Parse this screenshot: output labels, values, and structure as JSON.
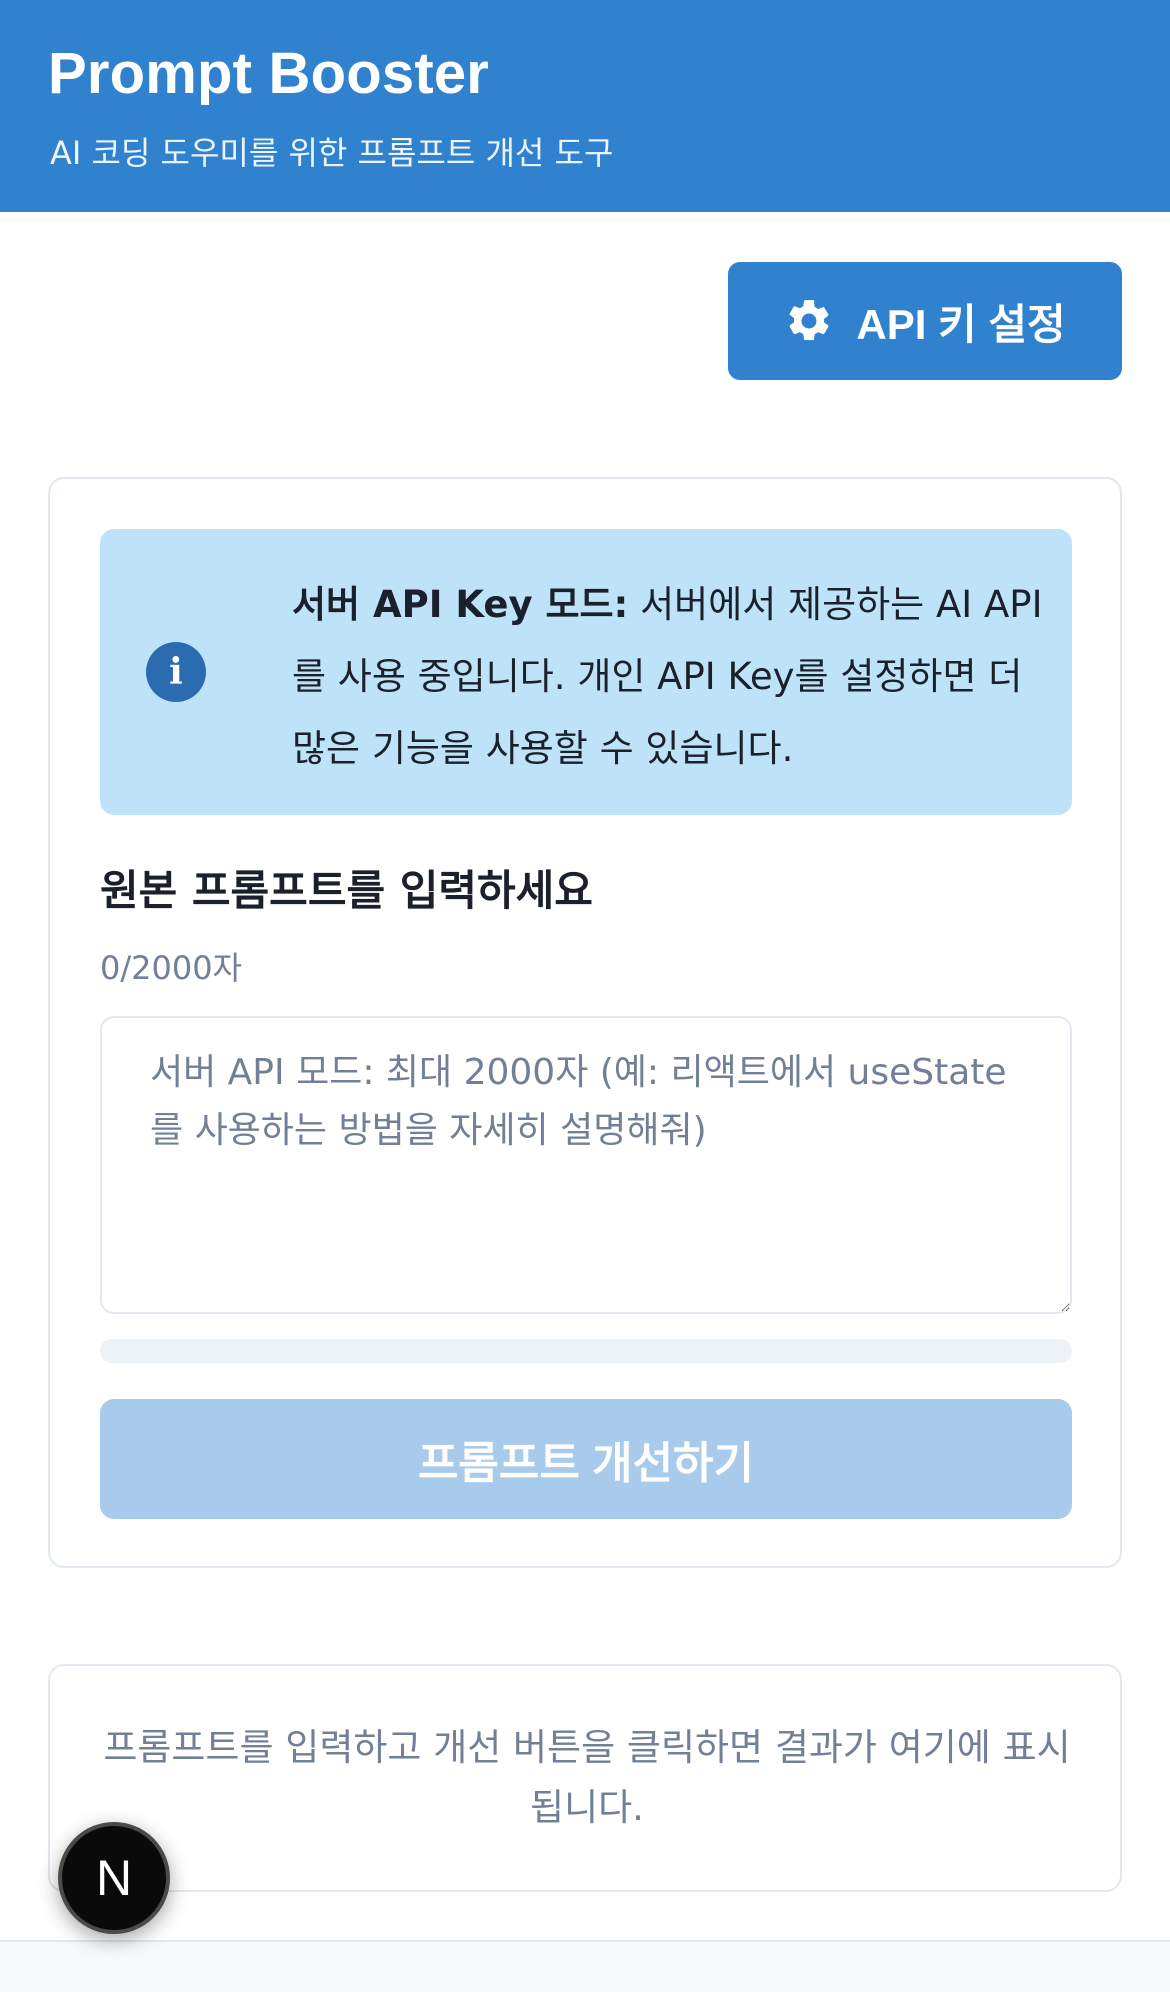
{
  "header": {
    "title": "Prompt Booster",
    "subtitle": "AI 코딩 도우미를 위한 프롬프트 개선 도구"
  },
  "toolbar": {
    "api_key_button_label": "API 키 설정",
    "api_key_button_icon": "gear-icon"
  },
  "info": {
    "icon": "info-icon",
    "bold": "서버 API Key 모드:",
    "message": " 서버에서 제공하는 AI API를 사용 중입니다. 개인 API Key를 설정하면 더 많은 기능을 사용할 수 있습니다."
  },
  "input": {
    "label": "원본 프롬프트를 입력하세요",
    "char_count": "0/2000자",
    "value": "",
    "placeholder": "서버 API 모드: 최대 2000자 (예: 리액트에서 useState를 사용하는 방법을 자세히 설명해줘)",
    "progress": 0
  },
  "actions": {
    "improve_label": "프롬프트 개선하기"
  },
  "result": {
    "placeholder": "프롬프트를 입력하고 개선 버튼을 클릭하면 결과가 여기에 표시됩니다."
  },
  "badge": {
    "letter": "N"
  },
  "colors": {
    "primary": "#3182ce",
    "info_bg": "#bee3f8",
    "info_icon": "#2b6cb0",
    "disabled_button": "#a9cbeb",
    "border": "#e2e8f0",
    "muted_text": "#718096"
  }
}
